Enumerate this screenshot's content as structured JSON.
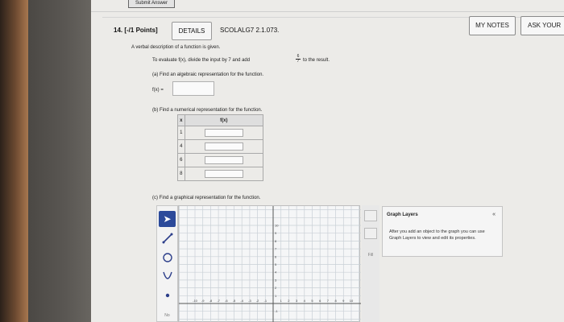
{
  "submit_label": "Submit Answer",
  "question": {
    "number": "14. [-/1 Points]",
    "details_label": "DETAILS",
    "code": "SCOLALG7 2.1.073.",
    "my_notes_label": "MY NOTES",
    "ask_label": "ASK YOUR"
  },
  "intro": "A verbal description of a function is given.",
  "description": {
    "prefix": "To evaluate f(x), divide the input by 7 and add",
    "frac_num": "6",
    "frac_den": "7",
    "suffix": "to the result."
  },
  "part_a": {
    "prompt": "(a) Find an algebraic representation for the function.",
    "label": "f(x) =",
    "value": ""
  },
  "part_b": {
    "prompt": "(b) Find a numerical representation for the function.",
    "headers": [
      "x",
      "f(x)"
    ],
    "rows": [
      "1",
      "4",
      "6",
      "8"
    ]
  },
  "part_c": {
    "prompt": "(c) Find a graphical representation for the function.",
    "x_ticks": [
      "-10",
      "-9",
      "-8",
      "-7",
      "-6",
      "-5",
      "-4",
      "-3",
      "-2",
      "-1",
      "1",
      "2",
      "3",
      "4",
      "5",
      "6",
      "7",
      "8",
      "9",
      "10"
    ],
    "y_ticks": [
      "10",
      "9",
      "8",
      "7",
      "6",
      "5",
      "4",
      "3",
      "2",
      "1",
      "-1"
    ]
  },
  "fill_label": "Fill",
  "no_solution_label": "No",
  "graph_layers": {
    "title": "Graph Layers",
    "collapse": "«",
    "text": "After you add an object to the graph you can use Graph Layers to view and edit its properties."
  }
}
